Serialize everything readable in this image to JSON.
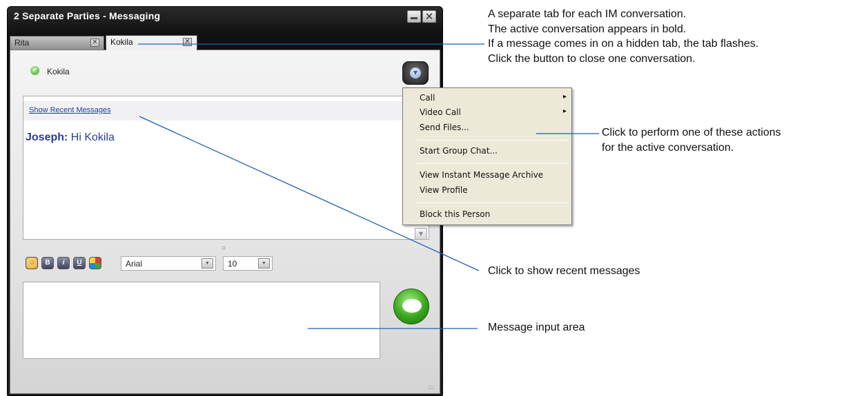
{
  "window": {
    "title": "2 Separate Parties - Messaging",
    "minimize_icon": "minimize-icon",
    "close_icon": "close-icon",
    "close_glyph": "✕"
  },
  "tabs": [
    {
      "label": "Rita",
      "active": false,
      "close_glyph": "✕"
    },
    {
      "label": "Kokila",
      "active": true,
      "close_glyph": "✕"
    }
  ],
  "contact": {
    "name": "Kokila",
    "status": "available",
    "status_glyph": "✔",
    "status_color": "#3ea527"
  },
  "actions_button": {
    "icon": "chevron-down-icon",
    "glyph": "▼"
  },
  "history": {
    "recent_link": "Show Recent Messages",
    "messages": [
      {
        "sender": "Joseph:",
        "text": " Hi Kokila"
      }
    ],
    "scroll_glyph": "▼"
  },
  "toolbar": {
    "emoticon": "☺",
    "bold": "B",
    "italic": "i",
    "underline": "U",
    "font": "Arial",
    "size": "10",
    "dropdown_glyph": "▼",
    "grip": ":::"
  },
  "menu": {
    "items": [
      "Call",
      "Video Call",
      "Send Files...",
      "Start Group Chat...",
      "View Instant Message Archive",
      "View Profile",
      "Block this Person"
    ]
  },
  "annotations": {
    "tabs": [
      "A separate tab for each IM conversation.",
      "The active conversation appears in bold.",
      "If a message comes in on a hidden tab, the tab flashes.",
      "Click the button to close one conversation."
    ],
    "actions": [
      "Click to perform one of these actions",
      "for the active conversation."
    ],
    "recent": "Click to show recent messages",
    "input": "Message input area"
  },
  "colors": {
    "callout_line": "#1c5fb5",
    "link": "#1e3c9c",
    "sender": "#2b3a9e"
  }
}
